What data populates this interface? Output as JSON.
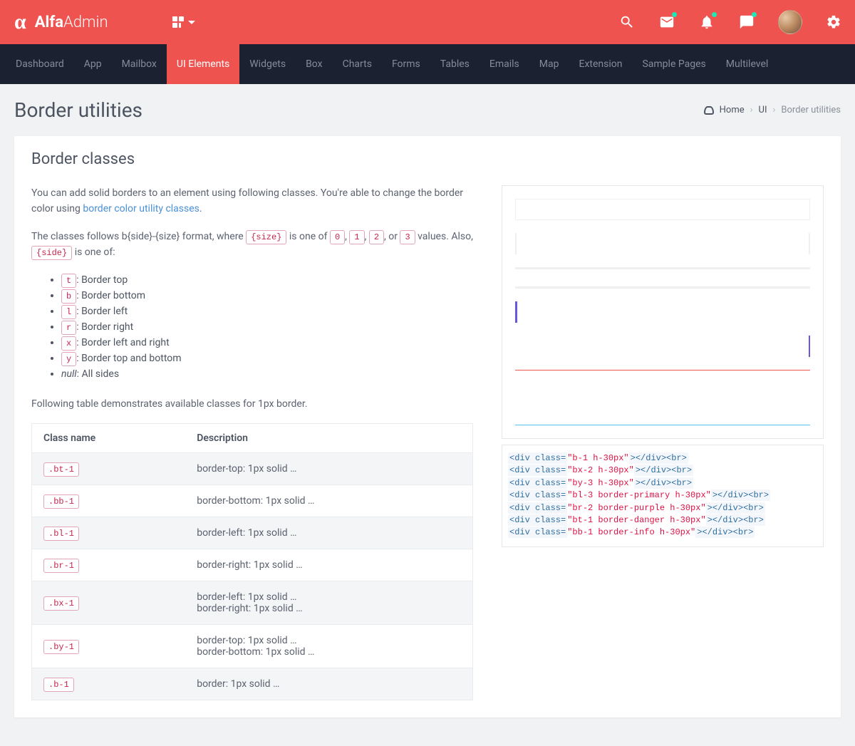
{
  "brand": {
    "bold": "Alfa",
    "light": "Admin"
  },
  "nav": {
    "items": [
      "Dashboard",
      "App",
      "Mailbox",
      "UI Elements",
      "Widgets",
      "Box",
      "Charts",
      "Forms",
      "Tables",
      "Emails",
      "Map",
      "Extension",
      "Sample Pages",
      "Multilevel"
    ],
    "active_index": 3
  },
  "page": {
    "title": "Border utilities",
    "breadcrumb": {
      "home": "Home",
      "section": "UI",
      "current": "Border utilities"
    }
  },
  "card": {
    "heading": "Border classes",
    "intro_prefix": "You can add solid borders to an element using following classes. You're able to change the border color using ",
    "intro_link": "border color utility classes",
    "intro_suffix": ".",
    "format_prefix": "The classes follows b{side}-{size} format, where ",
    "format_size_token": "{size}",
    "format_mid1": " is one of ",
    "size_values": [
      "0",
      "1",
      "2",
      "3"
    ],
    "format_mid2": " values. Also, ",
    "format_side_token": "{side}",
    "format_suffix": " is one of:",
    "side_options": [
      {
        "code": "t",
        "label": ": Border top"
      },
      {
        "code": "b",
        "label": ": Border bottom"
      },
      {
        "code": "l",
        "label": ": Border left"
      },
      {
        "code": "r",
        "label": ": Border right"
      },
      {
        "code": "x",
        "label": ": Border left and right"
      },
      {
        "code": "y",
        "label": ": Border top and bottom"
      },
      {
        "code": null,
        "null_text": "null",
        "label": ": All sides"
      }
    ],
    "table_intro": "Following table demonstrates available classes for 1px border.",
    "table_headers": {
      "class": "Class name",
      "desc": "Description"
    },
    "table_rows": [
      {
        "cls": ".bt-1",
        "desc": "border-top: 1px solid …"
      },
      {
        "cls": ".bb-1",
        "desc": "border-bottom: 1px solid …"
      },
      {
        "cls": ".bl-1",
        "desc": "border-left: 1px solid …"
      },
      {
        "cls": ".br-1",
        "desc": "border-right: 1px solid …"
      },
      {
        "cls": ".bx-1",
        "desc": "border-left: 1px solid …\nborder-right: 1px solid …"
      },
      {
        "cls": ".by-1",
        "desc": "border-top: 1px solid …\nborder-bottom: 1px solid …"
      },
      {
        "cls": ".b-1",
        "desc": "border: 1px solid …"
      }
    ],
    "code_lines": [
      {
        "cls": "b-1 h-30px"
      },
      {
        "cls": "bx-2 h-30px"
      },
      {
        "cls": "by-3 h-30px"
      },
      {
        "cls": "bl-3 border-primary h-30px"
      },
      {
        "cls": "br-2 border-purple h-30px"
      },
      {
        "cls": "bt-1 border-danger h-30px"
      },
      {
        "cls": "bb-1 border-info h-30px"
      }
    ]
  }
}
